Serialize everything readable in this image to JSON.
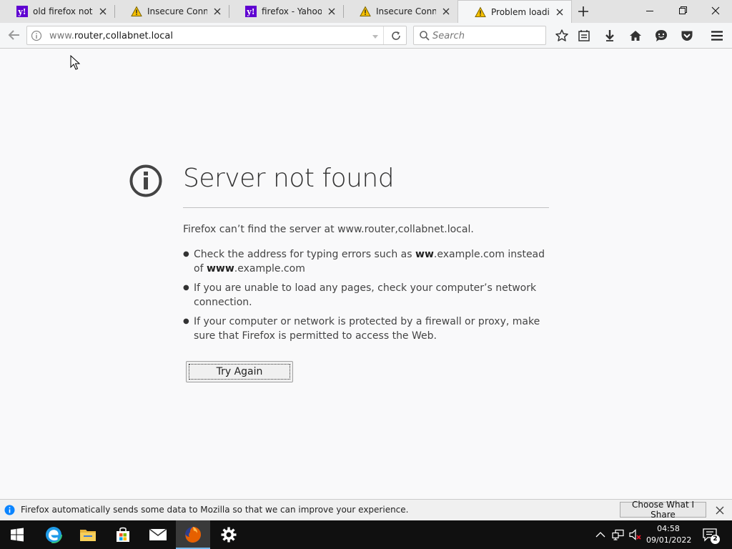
{
  "window": {
    "tabs": [
      {
        "title": "old firefox not lo...",
        "favicon": "yahoo-icon",
        "active": false
      },
      {
        "title": "Insecure Connec...",
        "favicon": "warning-icon",
        "active": false
      },
      {
        "title": "firefox - Yahoo S...",
        "favicon": "yahoo-icon",
        "active": false
      },
      {
        "title": "Insecure Connec...",
        "favicon": "warning-icon",
        "active": false
      },
      {
        "title": "Problem loading...",
        "favicon": "warning-icon",
        "active": true
      }
    ],
    "yahoo_glyph": "y!"
  },
  "navbar": {
    "url_prefix": "www.",
    "url_rest": "router,collabnet.local",
    "search_placeholder": "Search",
    "toolbar_icons": [
      "bookmark-star-icon",
      "reading-list-icon",
      "download-icon",
      "home-icon",
      "chat-icon",
      "pocket-icon",
      "menu-icon"
    ]
  },
  "error_page": {
    "title": "Server not found",
    "description": "Firefox can’t find the server at www.router,collabnet.local.",
    "bullets": [
      {
        "pre": "Check the address for typing errors such as ",
        "b1": "ww",
        "mid": ".example.com instead of ",
        "b2": "www",
        "post": ".example.com"
      },
      {
        "text": "If you are unable to load any pages, check your computer’s network connection."
      },
      {
        "text": "If your computer or network is protected by a firewall or proxy, make sure that Firefox is permitted to access the Web."
      }
    ],
    "try_again_label": "Try Again"
  },
  "notification": {
    "message": "Firefox automatically sends some data to Mozilla so that we can improve your experience.",
    "button_label": "Choose What I Share"
  },
  "taskbar": {
    "apps": [
      "windows-start-icon",
      "edge-icon",
      "file-explorer-icon",
      "store-icon",
      "mail-icon",
      "firefox-icon",
      "settings-icon"
    ],
    "active_app": "firefox-icon",
    "clock_time": "04:58",
    "clock_date": "09/01/2022",
    "notification_count": "2"
  },
  "colors": {
    "accent": "#0a84ff",
    "taskbar": "#101010",
    "warning": "#f6c000",
    "yahoo": "#5f01d1"
  }
}
